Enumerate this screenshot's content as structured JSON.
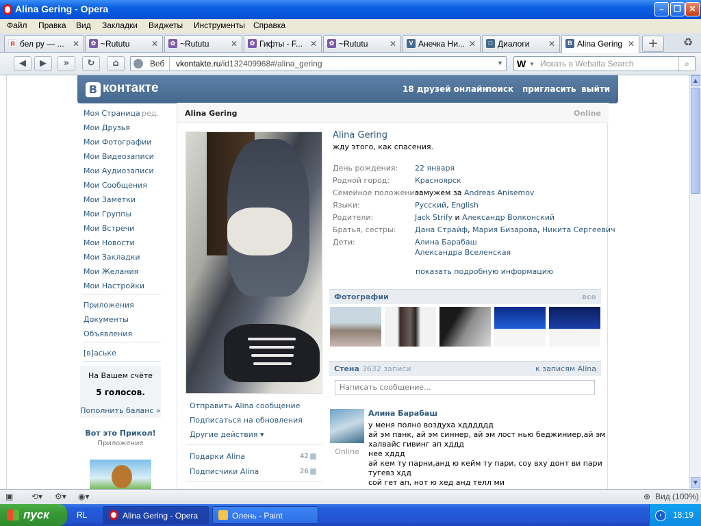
{
  "window": {
    "title": "Alina Gering - Opera"
  },
  "menu": [
    "Файл",
    "Правка",
    "Вид",
    "Закладки",
    "Виджеты",
    "Инструменты",
    "Справка"
  ],
  "tabs": [
    {
      "label": "бел ру — ...",
      "fav": "Я",
      "color": "#e01a1a"
    },
    {
      "label": "~Rututu",
      "fav": "✿",
      "color": "#7a5aa8"
    },
    {
      "label": "~Rututu",
      "fav": "✿",
      "color": "#7a5aa8"
    },
    {
      "label": "Гифты - F...",
      "fav": "✿",
      "color": "#7a5aa8"
    },
    {
      "label": "~Rututu",
      "fav": "✿",
      "color": "#7a5aa8"
    },
    {
      "label": "Анечка Ни...",
      "fav": "V",
      "color": "#45688e"
    },
    {
      "label": "Диалоги",
      "fav": "□",
      "color": "#45688e"
    },
    {
      "label": "Alina Gering",
      "fav": "B",
      "color": "#45688e"
    }
  ],
  "address": {
    "mode": "Веб",
    "domain": "vkontakte.ru",
    "path": "/id132409968#/alina_gering"
  },
  "search": {
    "engine": "W",
    "placeholder": "Искать в Webalta Search"
  },
  "vk": {
    "logo": "контакте",
    "logo_letter": "B",
    "header_links": [
      "18 друзей онлайн",
      "поиск",
      "пригласить",
      "выйти"
    ],
    "menu": [
      "Моя Страница",
      "Мои Друзья",
      "Мои Фотографии",
      "Мои Видеозаписи",
      "Мои Аудиозаписи",
      "Мои Сообщения",
      "Мои Заметки",
      "Мои Группы",
      "Мои Встречи",
      "Мои Новости",
      "Мои Закладки",
      "Мои Желания",
      "Мои Настройки"
    ],
    "edit": "ред.",
    "menu2": [
      "Приложения",
      "Документы",
      "Объявления"
    ],
    "menu3": "[в]аське",
    "balance": {
      "label": "На Вашем счёте",
      "amount": "5 голосов.",
      "link": "Пополнить баланс »"
    },
    "promo": {
      "title": "Вот это Прикол!",
      "subtitle": "Приложение"
    },
    "profile": {
      "name": "Alina Gering",
      "online": "Online",
      "status": "жду этого, как спасения.",
      "info": [
        {
          "label": "День рождения:",
          "value": "22 января"
        },
        {
          "label": "Родной город:",
          "value": "Красноярск"
        },
        {
          "label": "Семейное положение:",
          "value": "замужем за ",
          "value2": "Andreas Anisemov"
        },
        {
          "label": "Языки:",
          "value": "Русский",
          "value2": ", ",
          "value3": "English"
        },
        {
          "label": "Родители:",
          "value": "Jack Strify",
          "value2": " и ",
          "value3": "Александр Волконский"
        },
        {
          "label": "Братья, сестры:",
          "value": "Дана Страйф",
          "value2": ", ",
          "value3": "Мария Бизарова",
          "value4": ", ",
          "value5": "Никита Сергеевич"
        },
        {
          "label": "Дети:",
          "value": "Алина Барабаш",
          "value_line2": "Александра Вселенская"
        }
      ],
      "more": "показать подробную информацию",
      "actions": [
        "Отправить Alina сообщение",
        "Подписаться на обновления",
        "Другие действия ▾"
      ],
      "gifts": {
        "label": "Подарки Alina",
        "count": "42"
      },
      "subscribers": {
        "label": "Подписчики Alina",
        "count": "26"
      },
      "photos_title": "Фотографии",
      "photos_all": "все",
      "wall_title": "Стена",
      "wall_count": "3632 записи",
      "wall_link": "к записям Alina",
      "compose_placeholder": "Написать сообщение..."
    },
    "post": {
      "author": "Алина Барабаш",
      "online": "Online",
      "lines": [
        "у меня полно воздуха хдддддд",
        "ай эм панк, ай эм синнер, ай эм лост нью беджиниер,ай эм",
        "халвайс гивинг ап хддд",
        "нее хддд",
        "ай кем ту парни,анд ю кейм ту пари, соу вху донт ви пари",
        "тугевз хдд",
        "сой гет ап, нот ю хед анд телл ми"
      ]
    }
  },
  "statusbar": {
    "zoom": "Вид (100%)"
  },
  "taskbar": {
    "start": "пуск",
    "lang": "RL",
    "items": [
      "Alina Gering - Opera",
      "Олень - Paint"
    ],
    "clock": "18:19"
  }
}
